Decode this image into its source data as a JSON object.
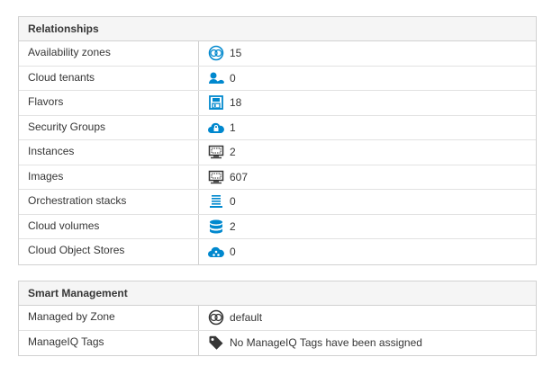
{
  "relationships": {
    "title": "Relationships",
    "rows": [
      {
        "label": "Availability zones",
        "value": "15",
        "icon": "availability-zone-icon"
      },
      {
        "label": "Cloud tenants",
        "value": "0",
        "icon": "cloud-tenant-icon"
      },
      {
        "label": "Flavors",
        "value": "18",
        "icon": "flavor-icon"
      },
      {
        "label": "Security Groups",
        "value": "1",
        "icon": "security-group-icon"
      },
      {
        "label": "Instances",
        "value": "2",
        "icon": "instance-icon"
      },
      {
        "label": "Images",
        "value": "607",
        "icon": "image-icon"
      },
      {
        "label": "Orchestration stacks",
        "value": "0",
        "icon": "orchestration-stack-icon"
      },
      {
        "label": "Cloud volumes",
        "value": "2",
        "icon": "cloud-volume-icon"
      },
      {
        "label": "Cloud Object Stores",
        "value": "0",
        "icon": "object-store-icon"
      }
    ]
  },
  "smart_management": {
    "title": "Smart Management",
    "rows": [
      {
        "label": "Managed by Zone",
        "value": "default",
        "icon": "zone-icon"
      },
      {
        "label": "ManageIQ Tags",
        "value": "No ManageIQ Tags have been assigned",
        "icon": "tag-icon"
      }
    ]
  },
  "colors": {
    "icon_blue": "#0088ce",
    "icon_dark": "#363636",
    "text": "#363636",
    "header_bg": "#f5f5f5",
    "border": "#d1d1d1"
  }
}
